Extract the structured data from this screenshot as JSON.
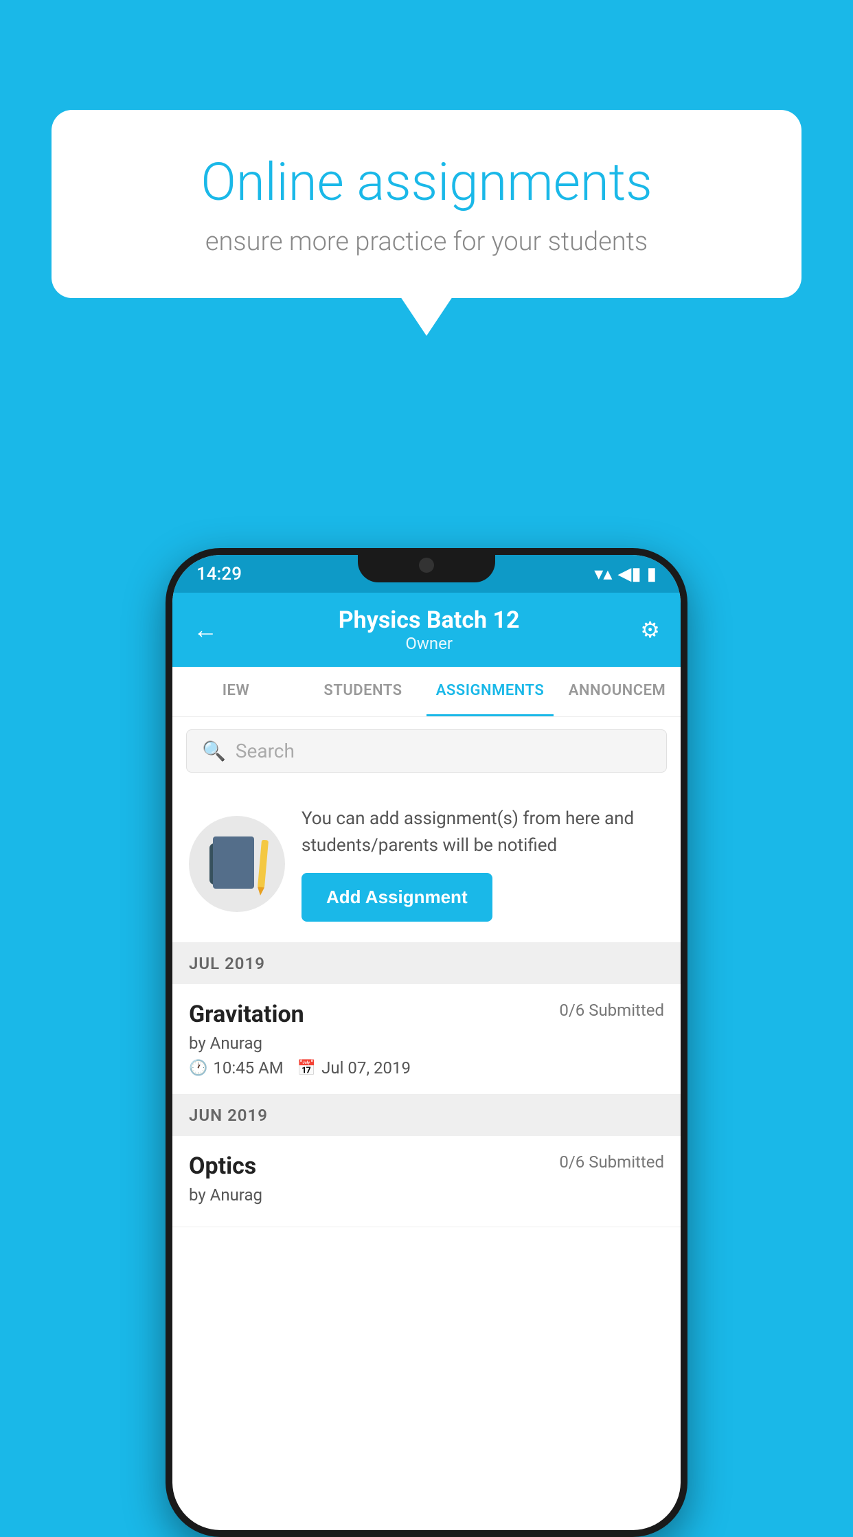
{
  "background_color": "#1ab8e8",
  "speech_bubble": {
    "title": "Online assignments",
    "subtitle": "ensure more practice for your students"
  },
  "status_bar": {
    "time": "14:29"
  },
  "header": {
    "title": "Physics Batch 12",
    "subtitle": "Owner"
  },
  "tabs": [
    {
      "label": "IEW",
      "active": false
    },
    {
      "label": "STUDENTS",
      "active": false
    },
    {
      "label": "ASSIGNMENTS",
      "active": true
    },
    {
      "label": "ANNOUNCEM...",
      "active": false
    }
  ],
  "search": {
    "placeholder": "Search"
  },
  "info_block": {
    "description": "You can add assignment(s) from here and students/parents will be notified",
    "button_label": "Add Assignment"
  },
  "sections": [
    {
      "month": "JUL 2019",
      "assignments": [
        {
          "name": "Gravitation",
          "submitted": "0/6 Submitted",
          "by": "by Anurag",
          "time": "10:45 AM",
          "date": "Jul 07, 2019"
        }
      ]
    },
    {
      "month": "JUN 2019",
      "assignments": [
        {
          "name": "Optics",
          "submitted": "0/6 Submitted",
          "by": "by Anurag",
          "time": "",
          "date": ""
        }
      ]
    }
  ]
}
